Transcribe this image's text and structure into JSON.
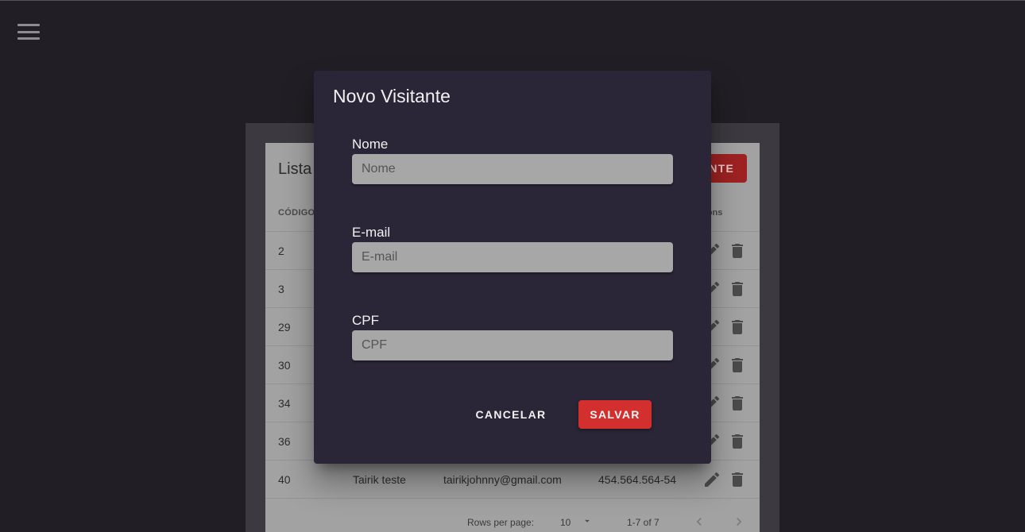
{
  "app": {
    "menu_icon": "hamburger-menu-icon"
  },
  "list": {
    "title": "Lista",
    "add_button_label": "NTE",
    "columns": {
      "code": "CÓDIGO",
      "actions": "ctions"
    },
    "rows": [
      {
        "code": "2",
        "name": "",
        "email": "",
        "cpf": ""
      },
      {
        "code": "3",
        "name": "",
        "email": "",
        "cpf": ""
      },
      {
        "code": "29",
        "name": "",
        "email": "",
        "cpf": ""
      },
      {
        "code": "30",
        "name": "",
        "email": "",
        "cpf": ""
      },
      {
        "code": "34",
        "name": "",
        "email": "",
        "cpf": ""
      },
      {
        "code": "36",
        "name": "",
        "email": "",
        "cpf": ""
      },
      {
        "code": "40",
        "name": "Tairik teste",
        "email": "tairikjohnny@gmail.com",
        "cpf": "454.564.564-54"
      }
    ],
    "row_actions": {
      "edit_icon": "pencil-icon",
      "delete_icon": "trash-icon"
    },
    "pagination": {
      "rows_per_page_label": "Rows per page:",
      "rows_per_page_value": "10",
      "range": "1-7 of 7"
    }
  },
  "dialog": {
    "title": "Novo Visitante",
    "fields": [
      {
        "label": "Nome",
        "placeholder": "Nome",
        "value": ""
      },
      {
        "label": "E-mail",
        "placeholder": "E-mail",
        "value": ""
      },
      {
        "label": "CPF",
        "placeholder": "CPF",
        "value": ""
      }
    ],
    "cancel_label": "CANCELAR",
    "save_label": "SALVAR"
  },
  "colors": {
    "page_bg": "#211f25",
    "dialog_bg": "#2a2637",
    "accent": "#d32f2f"
  }
}
